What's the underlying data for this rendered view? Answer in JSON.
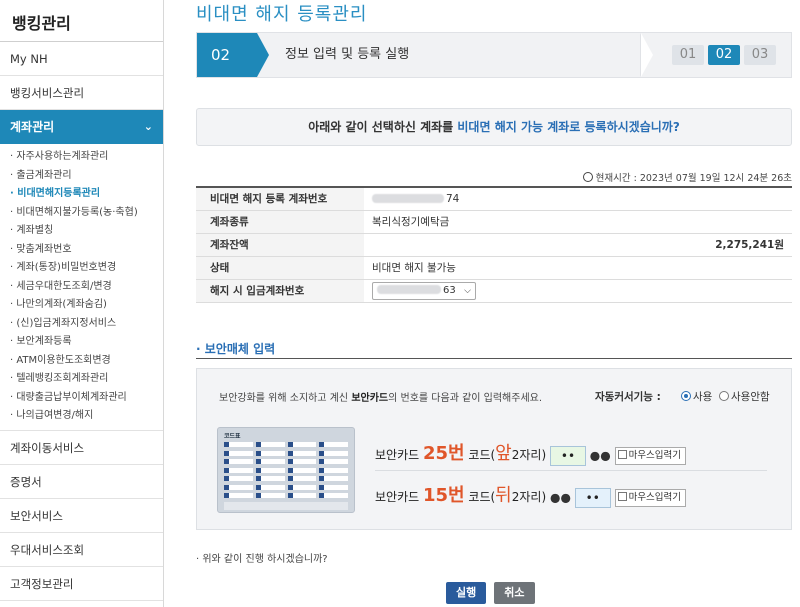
{
  "sidebar": {
    "title": "뱅킹관리",
    "top_items": [
      {
        "label": "My NH"
      },
      {
        "label": "뱅킹서비스관리"
      }
    ],
    "active": {
      "label": "계좌관리",
      "chevron": "chevron-down-icon"
    },
    "sub_items": [
      {
        "label": "· 자주사용하는계좌관리"
      },
      {
        "label": "· 출금계좌관리"
      },
      {
        "label": "· 비대면해지등록관리"
      },
      {
        "label": "· 비대면해지불가등록(농·축협)"
      },
      {
        "label": "· 계좌별칭"
      },
      {
        "label": "· 맞춤계좌번호"
      },
      {
        "label": "· 계좌(통장)비밀번호변경"
      },
      {
        "label": "· 세금우대한도조회/변경"
      },
      {
        "label": "· 나만의계좌(계좌숨김)"
      },
      {
        "label": "· (신)입금계좌지정서비스"
      },
      {
        "label": "· 보안계좌등록"
      },
      {
        "label": "· ATM이용한도조회변경"
      },
      {
        "label": "· 텔레뱅킹조회계좌관리"
      },
      {
        "label": "· 대량출금납부이체계좌관리"
      },
      {
        "label": "· 나의급여변경/해지"
      }
    ],
    "bottom_items": [
      {
        "label": "계좌이동서비스"
      },
      {
        "label": "증명서"
      },
      {
        "label": "보안서비스"
      },
      {
        "label": "우대서비스조회"
      },
      {
        "label": "고객정보관리"
      }
    ]
  },
  "page_title": "비대면 해지 등록관리",
  "stepbar": {
    "current": "02",
    "label": "정보 입력 및 등록 실행",
    "steps": [
      "01",
      "02",
      "03"
    ]
  },
  "notice": {
    "pre": "아래와 같이 선택하신 계좌를 ",
    "highlight": "비대면 해지 가능 계좌로 등록하시겠습니까?"
  },
  "time": {
    "label": "현재시간 : 2023년 07월 19일 12시 24분 26초"
  },
  "info": {
    "account_label": "비대면 해지 등록 계좌번호",
    "account_suffix": "74",
    "type_label": "계좌종류",
    "type_value": "복리식정기예탁금",
    "balance_label": "계좌잔액",
    "balance_value": "2,275,241원",
    "status_label": "상태",
    "status_value": "비대면 해지 불가능",
    "deposit_label": "해지 시 입금계좌번호",
    "deposit_suffix": "63"
  },
  "security": {
    "title": "· 보안매체 입력",
    "desc_pre": "보안강화를 위해 소지하고 계신 ",
    "desc_bold": "보안카드",
    "desc_post": "의 번호를 다음과 같이 입력해주세요.",
    "auto_label": "자동커서기능 :",
    "radio_use": "사용",
    "radio_nouse": "사용안함",
    "card_title": "코드표",
    "row1": {
      "pre": "보안카드 ",
      "num": "25번",
      "mid": " 코드(",
      "pos": "앞",
      "post": "2자리)",
      "value": "••",
      "after": "●●"
    },
    "row2": {
      "pre": "보안카드 ",
      "num": "15번",
      "mid": " 코드(",
      "pos": "뒤",
      "post": "2자리)",
      "before": "●●",
      "value": "••"
    },
    "mouse_label": "마우스입력기"
  },
  "question": "· 위와 같이 진행 하시겠습니까?",
  "buttons": {
    "ok": "실행",
    "cancel": "취소"
  }
}
